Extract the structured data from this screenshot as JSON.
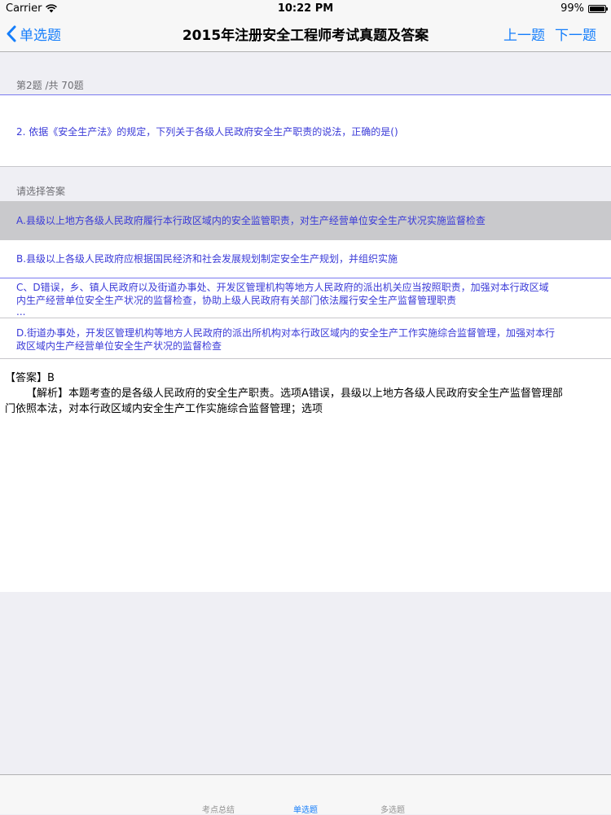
{
  "status_bar": {
    "carrier": "Carrier",
    "time": "10:22 PM",
    "battery_text": "99%",
    "battery_level": 0.99
  },
  "nav": {
    "back_label": "单选题",
    "title": "2015年注册安全工程师考试真题及答案",
    "prev_label": "上一题",
    "next_label": "下一题",
    "accent_color": "#157efb"
  },
  "question": {
    "counter": "第2题 /共 70题",
    "text": "2. 依据《安全生产法》的规定，下列关于各级人民政府安全生产职责的说法，正确的是()"
  },
  "answers": {
    "header": "请选择答案",
    "options": [
      {
        "line1": "A.县级以上地方各级人民政府履行本行政区域内的安全监管职责，对生产经营单位安全生产状况实施监督检查",
        "line2": "",
        "more": ""
      },
      {
        "line1": "B.县级以上各级人民政府应根据国民经济和社会发展规划制定安全生产规划，并组织实施",
        "line2": "",
        "more": ""
      },
      {
        "line1": "C、D错误，乡、镇人民政府以及街道办事处、开发区管理机构等地方人民政府的派出机关应当按照职责，加强对本行政区域",
        "line2": "内生产经营单位安全生产状况的监督检查，协助上级人民政府有关部门依法履行安全生产监督管理职责",
        "more": "..."
      },
      {
        "line1": "D.街道办事处，开发区管理机构等地方人民政府的派出所机构对本行政区域内的安全生产工作实施综合监督管理，加强对本行",
        "line2": "政区域内生产经营单位安全生产状况的监督检查",
        "more": ""
      }
    ],
    "selected_index": 0
  },
  "explanation": {
    "answer": "【答案】B",
    "analysis_1": "【解析】本题考查的是各级人民政府的安全生产职责。选项A错误，县级以上地方各级人民政府安全生产监督管理部",
    "analysis_2": "门依照本法，对本行政区域内安全生产工作实施综合监督管理；选项"
  },
  "tabs": [
    {
      "label": "考点总结"
    },
    {
      "label": "单选题"
    },
    {
      "label": "多选题"
    }
  ],
  "active_tab_index": 1
}
